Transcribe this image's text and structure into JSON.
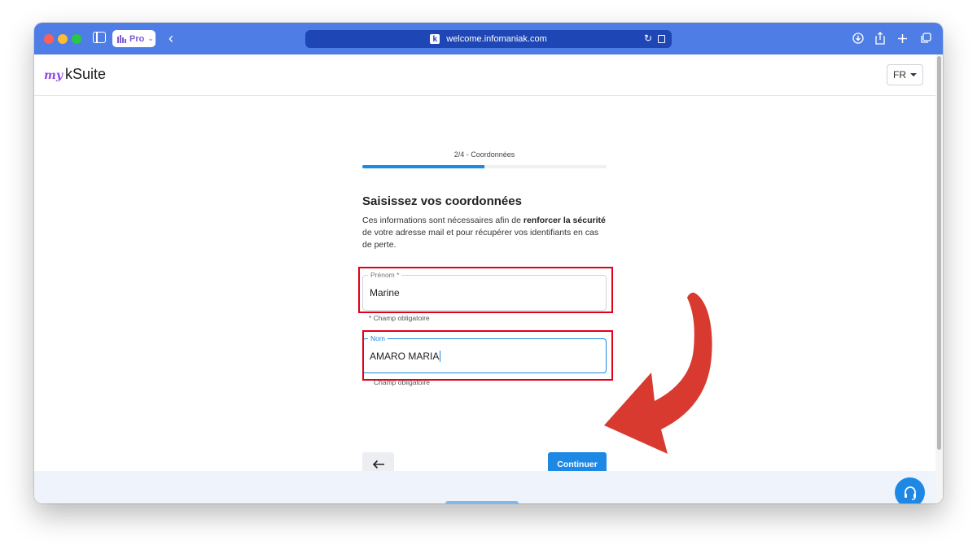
{
  "browser": {
    "profile_label": "Pro",
    "url": "welcome.infomaniak.com",
    "url_favicon": "k"
  },
  "header": {
    "logo_prefix": "my",
    "logo_name": "kSuite",
    "language": "FR"
  },
  "stepper": {
    "label": "2/4 - Coordonnées",
    "progress": 0.5
  },
  "form": {
    "title": "Saisissez vos coordonnées",
    "desc_part1": "Ces informations sont nécessaires afin de ",
    "desc_bold": "renforcer la sécurité",
    "desc_part2": " de votre adresse mail et pour récupérer vos identifiants en cas de perte.",
    "firstname": {
      "label": "Prénom *",
      "value": "Marine",
      "helper": "* Champ obligatoire"
    },
    "lastname": {
      "label": "Nom",
      "value": "AMARO MARIA",
      "helper": "Champ obligatoire"
    },
    "continue_label": "Continuer"
  },
  "icons": {
    "back": "arrow-left-icon",
    "support": "headset-icon"
  },
  "colors": {
    "toolbar": "#4e7ee5",
    "primary": "#1e88e5",
    "highlight_box": "#e0001a",
    "annotation_arrow": "#d93a30"
  }
}
